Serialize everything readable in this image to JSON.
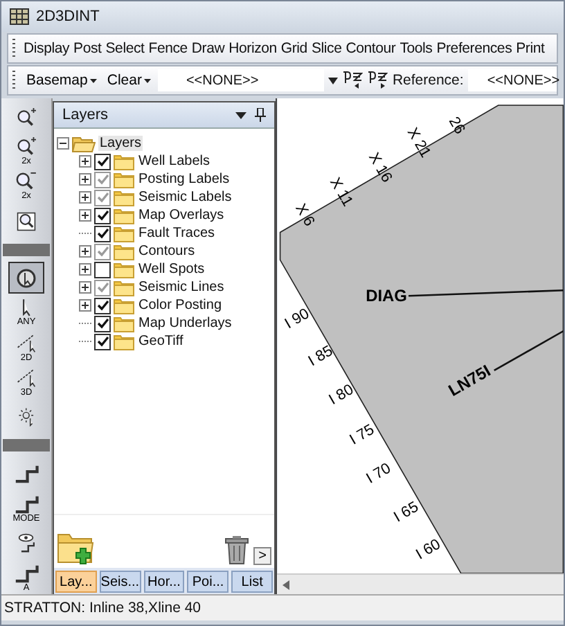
{
  "window": {
    "title": "2D3DINT"
  },
  "menu": [
    "Display",
    "Post",
    "Select",
    "Fence",
    "Draw",
    "Horizon",
    "Grid",
    "Slice",
    "Contour",
    "Tools",
    "Preferences",
    "Print"
  ],
  "toolbar": {
    "basemap": "Basemap",
    "clear": "Clear",
    "selection": "<<NONE>>",
    "reference_label": "Reference:",
    "reference": "<<NONE>>"
  },
  "tool_groups": [
    [
      {
        "kind": "zoom-in",
        "selected": false
      },
      {
        "kind": "zoom-in",
        "text": "2x",
        "selected": false
      },
      {
        "kind": "zoom-out",
        "text": "2x",
        "selected": false
      },
      {
        "kind": "zoom-box",
        "selected": false
      }
    ],
    [
      {
        "kind": "pointer-target",
        "selected": true
      },
      {
        "kind": "pointer",
        "text": "ANY",
        "selected": false
      },
      {
        "kind": "measure",
        "text": "2D",
        "selected": false
      },
      {
        "kind": "measure",
        "text": "3D",
        "selected": false
      },
      {
        "kind": "sun-pointer",
        "selected": false
      }
    ],
    [
      {
        "kind": "step",
        "selected": false
      },
      {
        "kind": "step",
        "text": "MODE",
        "selected": false
      },
      {
        "kind": "eye-step",
        "selected": false
      },
      {
        "kind": "step",
        "text": "A",
        "selected": false
      }
    ]
  ],
  "layers_panel": {
    "title": "Layers",
    "root": {
      "label": "Layers",
      "expanded": true,
      "selected": true,
      "children": [
        {
          "label": "Well Labels",
          "expandable": true,
          "checked": true,
          "grayed": false,
          "selected": false
        },
        {
          "label": "Posting Labels",
          "expandable": true,
          "checked": true,
          "grayed": true,
          "selected": false
        },
        {
          "label": "Seismic Labels",
          "expandable": true,
          "checked": true,
          "grayed": true,
          "selected": false
        },
        {
          "label": "Map Overlays",
          "expandable": true,
          "checked": true,
          "grayed": false,
          "selected": false
        },
        {
          "label": "Fault Traces",
          "expandable": false,
          "checked": true,
          "grayed": false,
          "selected": false
        },
        {
          "label": "Contours",
          "expandable": true,
          "checked": true,
          "grayed": true,
          "selected": false
        },
        {
          "label": "Well Spots",
          "expandable": true,
          "checked": false,
          "selected": false
        },
        {
          "label": "Seismic Lines",
          "expandable": true,
          "checked": true,
          "grayed": true,
          "selected": false
        },
        {
          "label": "Color Posting",
          "expandable": true,
          "checked": true,
          "grayed": false,
          "selected": false
        },
        {
          "label": "Map Underlays",
          "expandable": false,
          "checked": true,
          "grayed": false,
          "selected": false
        },
        {
          "label": "GeoTiff",
          "expandable": false,
          "checked": true,
          "grayed": false,
          "selected": false
        }
      ]
    },
    "scroll_button": ">",
    "tabs": [
      {
        "label": "Lay...",
        "selected": true
      },
      {
        "label": "Seis...",
        "selected": false
      },
      {
        "label": "Hor...",
        "selected": false
      },
      {
        "label": "Poi...",
        "selected": false
      },
      {
        "label": "List",
        "selected": false
      }
    ]
  },
  "map": {
    "xline_labels": [
      "X 6",
      "X 11",
      "X 16",
      "X 21",
      "26"
    ],
    "line_labels": [
      "DIAG",
      "LN75I"
    ],
    "inline_labels": [
      "I 90",
      "I 85",
      "I 80",
      "I 75",
      "I 70",
      "I 65",
      "I 60"
    ]
  },
  "status_bar": "STRATTON: Inline 38,Xline 40"
}
